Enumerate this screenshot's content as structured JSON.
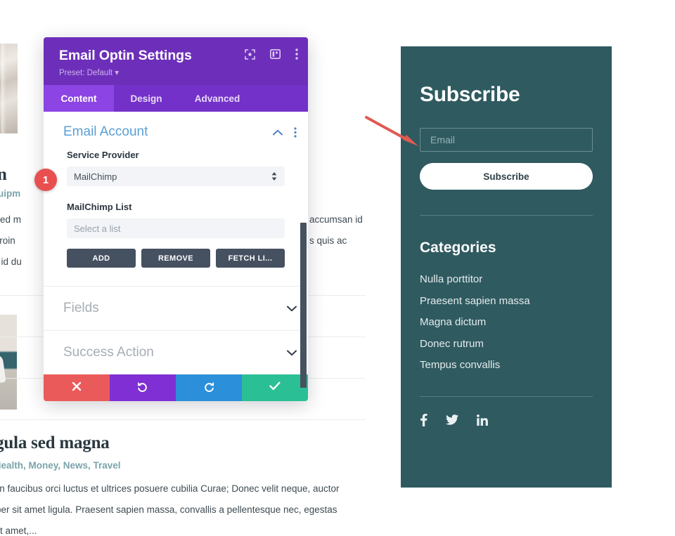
{
  "background_page": {
    "posts": [
      {
        "title_visible": "on n",
        "categories_visible": "g, Equipm",
        "body_lines": [
          "gula sed m",
          "em. Proin",
          "quam id du"
        ],
        "body_right_lines": [
          "accumsan id",
          "s quis ac"
        ]
      },
      {
        "title_visible": "s ligula sed magna",
        "categories_visible": "ent, Health, Money, News, Travel",
        "body_lines": [
          "rimis in faucibus orci luctus et ultrices posuere cubilia Curae; Donec velit neque, auctor",
          "mcorper sit amet ligula. Praesent sapien massa, convallis a pellentesque nec, egestas",
          "olor sit amet,..."
        ]
      }
    ]
  },
  "modal": {
    "title": "Email Optin Settings",
    "preset": "Preset: Default",
    "preset_caret": "▾",
    "header_icons": [
      {
        "name": "focus-target-icon"
      },
      {
        "name": "layout-panel-icon"
      },
      {
        "name": "more-vertical-icon"
      }
    ],
    "tabs": [
      {
        "label": "Content",
        "active": true
      },
      {
        "label": "Design",
        "active": false
      },
      {
        "label": "Advanced",
        "active": false
      }
    ],
    "sections": [
      {
        "title": "Email Account",
        "state": "expanded",
        "chevron": "chevron-up-icon",
        "fields": [
          {
            "label": "Service Provider",
            "type": "select",
            "value": "MailChimp",
            "options": [
              "MailChimp"
            ]
          },
          {
            "label": "MailChimp List",
            "type": "select",
            "placeholder": "Select a list",
            "value": ""
          }
        ],
        "buttons": [
          {
            "label": "ADD"
          },
          {
            "label": "REMOVE"
          },
          {
            "label": "FETCH LI..."
          }
        ]
      },
      {
        "title": "Fields",
        "state": "collapsed",
        "chevron": "chevron-down-icon"
      },
      {
        "title": "Success Action",
        "state": "collapsed",
        "chevron": "chevron-down-icon"
      }
    ],
    "footer_actions": [
      {
        "name": "cancel-button",
        "icon": "close-icon",
        "color": "#eb5a5a"
      },
      {
        "name": "undo-button",
        "icon": "undo-icon",
        "color": "#7f2fd4"
      },
      {
        "name": "redo-button",
        "icon": "redo-icon",
        "color": "#2b8fd9"
      },
      {
        "name": "save-button",
        "icon": "check-icon",
        "color": "#2bbf95"
      }
    ],
    "colors": {
      "header": "#6d2fba",
      "tabbar": "#7431c9",
      "tab_active": "#8c44e4"
    }
  },
  "annotations": {
    "step_badge": "1",
    "badge_color": "#e8504f",
    "arrow_color": "#e05a52"
  },
  "sidebar": {
    "title": "Subscribe",
    "email_placeholder": "Email",
    "email_value": "",
    "subscribe_label": "Subscribe",
    "categories_heading": "Categories",
    "categories": [
      "Nulla porttitor",
      "Praesent sapien massa",
      "Magna dictum",
      "Donec rutrum",
      "Tempus convallis"
    ],
    "social": [
      {
        "name": "facebook-icon"
      },
      {
        "name": "twitter-icon"
      },
      {
        "name": "linkedin-icon"
      }
    ],
    "background_color": "#2f5a60"
  }
}
